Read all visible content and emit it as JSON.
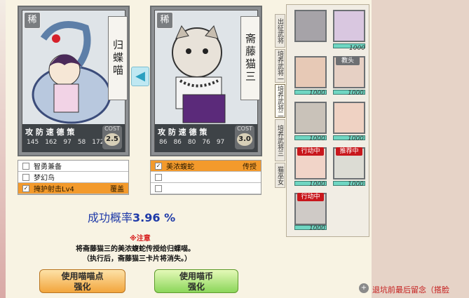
{
  "left_card": {
    "rarity": "稀",
    "name": "归蝶喵",
    "stat_labels": "攻 防 速 德 策",
    "stats": [
      "145",
      "162",
      "97",
      "58",
      "172"
    ],
    "cost_label": "COST",
    "cost": "2.5",
    "skills": [
      {
        "label": "智勇兼备",
        "right": "",
        "checked": false,
        "active": false
      },
      {
        "label": "梦幻鸟",
        "right": "",
        "checked": false,
        "active": false
      },
      {
        "label": "掩护射击Lv4",
        "right": "覆盖",
        "checked": true,
        "active": true
      }
    ]
  },
  "arrow": "◀",
  "right_card": {
    "rarity": "稀",
    "name": "斋藤猫三",
    "stat_labels": "攻 防 速 德 策",
    "stats": [
      "86",
      "86",
      "80",
      "76",
      "97"
    ],
    "cost_label": "COST",
    "cost": "3.0",
    "skills": [
      {
        "label": "美浓蝮蛇",
        "right": "传授",
        "checked": true,
        "active": true
      },
      {
        "label": "",
        "right": "",
        "checked": false,
        "active": false
      },
      {
        "label": "",
        "right": "",
        "checked": false,
        "active": false
      }
    ]
  },
  "success": {
    "label": "成功概率",
    "value": "3.96 %"
  },
  "notice": {
    "title": "※注意",
    "line1": "将斋藤猫三的美浓蝮蛇传授给归蝶喵。",
    "line2": "（执行后，斋藤猫三卡片将消失。）"
  },
  "buttons": {
    "points": "使用喵喵点\n强化",
    "coins": "使用喵币\n强化"
  },
  "tabs": [
    "出征武将",
    "培养武将一",
    "培养武将二",
    "培养武将三",
    "猫巫女"
  ],
  "roster": [
    {
      "level": "",
      "flag": ""
    },
    {
      "level": "1000",
      "flag": ""
    },
    {
      "level": "1000",
      "flag": ""
    },
    {
      "level": "1000",
      "flag": "教头"
    },
    {
      "level": "1000",
      "flag": ""
    },
    {
      "level": "1000",
      "flag": ""
    },
    {
      "level": "1000",
      "flag": "行动中"
    },
    {
      "level": "1000",
      "flag": "推荐中"
    },
    {
      "level": "1000",
      "flag": "行动中"
    }
  ],
  "footer_link": "退坑前最后留念（搭脸",
  "colors": {
    "accent_orange": "#f39a2c",
    "success_blue": "#1f3aa8",
    "notice_red": "#d61b1b"
  }
}
